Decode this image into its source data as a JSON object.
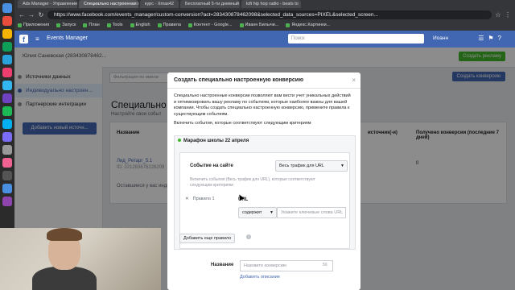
{
  "browser": {
    "tabs": [
      {
        "label": "Ads Manager - Управление ре"
      },
      {
        "label": "Специально настроенная кр"
      },
      {
        "label": "курс - Xmas42"
      },
      {
        "label": "Бесплатный 5-ти дневный м"
      },
      {
        "label": "lofi hip hop radio - beats to"
      }
    ],
    "url": "https://www.facebook.com/events_manager/custom-conversion?act=283430878462098&selected_data_sources=PIXEL&selected_screen...",
    "bookmarks": [
      {
        "label": "Приложения"
      },
      {
        "label": "Запуск"
      },
      {
        "label": "План"
      },
      {
        "label": "Tools"
      },
      {
        "label": "English"
      },
      {
        "label": "Правила"
      },
      {
        "label": "Контент - Google..."
      },
      {
        "label": "Иванн Билычи..."
      },
      {
        "label": "Яндекс.Картинки..."
      }
    ]
  },
  "fb": {
    "app_title": "Events Manager",
    "search_placeholder": "Поиск",
    "user_name": "Иоанн",
    "account_name": "Юлия Саневская (283430878462...",
    "create_ad_label": "Создать рекламу"
  },
  "sidebar": {
    "items": [
      {
        "label": "Источники данных"
      },
      {
        "label": "Индивидуально настроен..."
      },
      {
        "label": "Партнерские интеграции"
      }
    ],
    "add_source_label": "Добавить новый источн..."
  },
  "main": {
    "filter_placeholder": "Фильтрация по имени",
    "create_conv_label": "Создать конверсию",
    "heading": "Специально н",
    "subtext": "Настройте свои событ",
    "col_name": "Название",
    "col_source": "источник(-и)",
    "col_received": "Получено конверсии (последние 7 дней)",
    "row_name": "Лид_Ретарг_5.1",
    "row_id": "ID: 221283676226209",
    "row_value": "0",
    "row_note": "Оставшиеся у вас индиви"
  },
  "modal": {
    "title": "Создать специально настроенную конверсию",
    "description": "Специально настроенные конверсии позволяют вам вести учет уникальных действий и оптимизировать вашу рекламу по событиям, которые наиболее важны для вашей компании. Чтобы создать специально настроенную конверсию, примените правила к существующим событиям.",
    "criteria_label": "Включить события, которые соответствуют следующим критериям",
    "event_name": "Марафон школы 22 апреля",
    "event_on_site_label": "Событие на сайте",
    "traffic_select": "Весь трафик для URL",
    "hint": "Включить события (Весь трафик для URL), которые соответствуют следующим критериям:",
    "rule_label": "Правило 1",
    "url_label": "URL",
    "contains_select": "содержит",
    "keywords_placeholder": "Укажите ключевые слова URL",
    "add_rule_label": "Добавить еще правило",
    "name_label": "Название",
    "name_placeholder": "Назовите конверсию",
    "name_counter": "50",
    "add_description_label": "Добавить описание"
  }
}
